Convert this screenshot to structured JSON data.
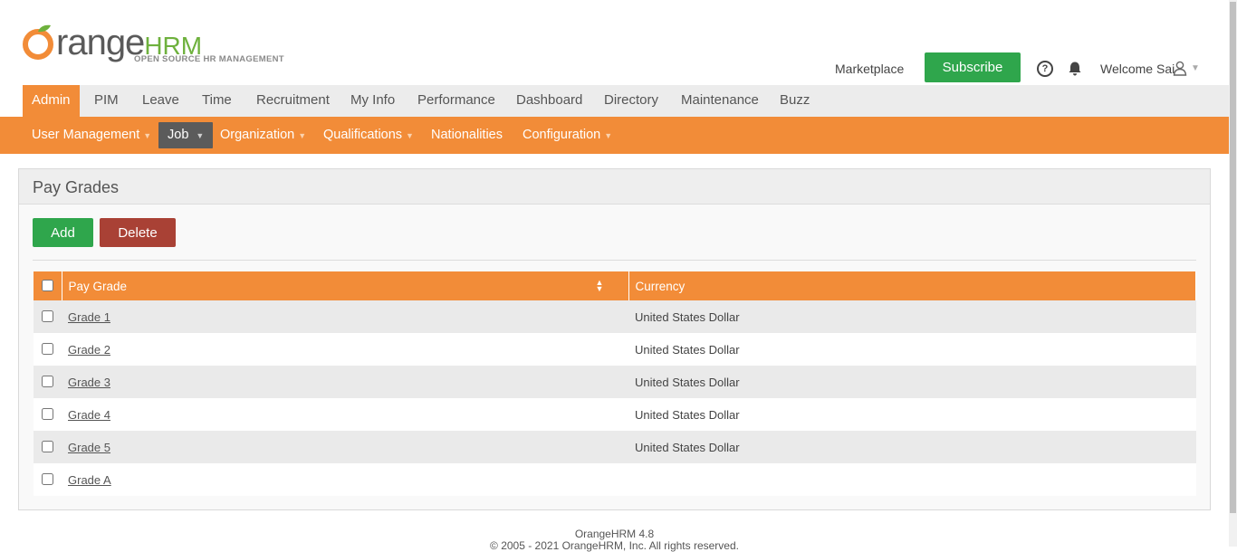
{
  "header": {
    "brand_main": "range",
    "brand_suffix": "HRM",
    "tagline": "OPEN SOURCE HR MANAGEMENT",
    "marketplace": "Marketplace",
    "subscribe": "Subscribe",
    "help": "?",
    "welcome": "Welcome Sai"
  },
  "main_nav": [
    {
      "label": "Admin",
      "active": true
    },
    {
      "label": "PIM"
    },
    {
      "label": "Leave"
    },
    {
      "label": "Time"
    },
    {
      "label": "Recruitment"
    },
    {
      "label": "My Info"
    },
    {
      "label": "Performance"
    },
    {
      "label": "Dashboard"
    },
    {
      "label": "Directory"
    },
    {
      "label": "Maintenance"
    },
    {
      "label": "Buzz"
    }
  ],
  "sub_nav": [
    {
      "label": "User Management"
    },
    {
      "label": "Job",
      "active": true
    },
    {
      "label": "Organization"
    },
    {
      "label": "Qualifications"
    },
    {
      "label": "Nationalities"
    },
    {
      "label": "Configuration"
    }
  ],
  "panel": {
    "title": "Pay Grades",
    "add": "Add",
    "delete": "Delete"
  },
  "table": {
    "headers": [
      "Pay Grade",
      "Currency"
    ],
    "rows": [
      {
        "grade": "Grade 1",
        "currency": "United States Dollar"
      },
      {
        "grade": "Grade 2",
        "currency": "United States Dollar"
      },
      {
        "grade": "Grade 3",
        "currency": "United States Dollar"
      },
      {
        "grade": "Grade 4",
        "currency": "United States Dollar"
      },
      {
        "grade": "Grade 5",
        "currency": "United States Dollar"
      },
      {
        "grade": "Grade A",
        "currency": ""
      }
    ]
  },
  "footer": {
    "version": "OrangeHRM 4.8",
    "copyright": "© 2005 - 2021 OrangeHRM, Inc. All rights reserved."
  },
  "colors": {
    "accent_orange": "#f28c38",
    "success_green": "#2fa64c",
    "danger_red": "#a94135",
    "active_submenu": "#5b5b5b"
  },
  "icons": [
    "orange-logo-icon",
    "help-icon",
    "bell-icon",
    "user-icon",
    "sort-icon",
    "caret-down-icon"
  ]
}
